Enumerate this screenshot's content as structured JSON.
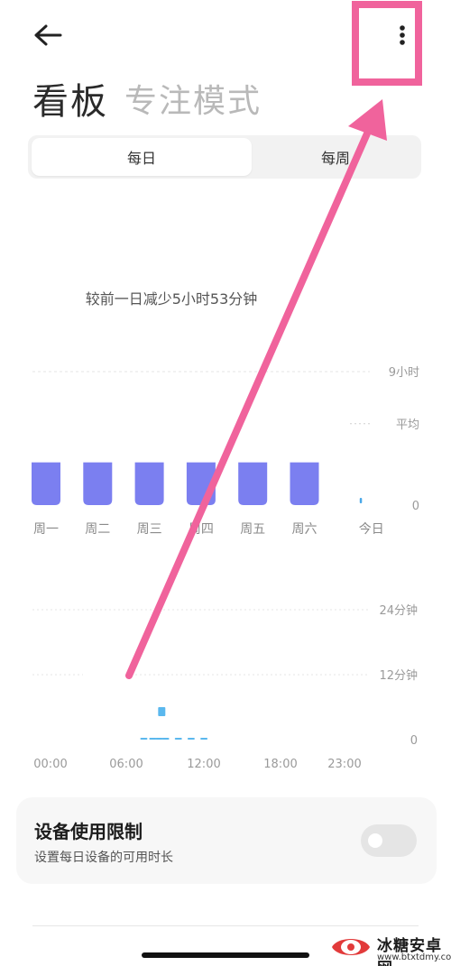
{
  "header": {
    "back_icon": "arrow-left-icon",
    "more_icon": "more-vertical-icon",
    "title": "看板",
    "subtitle": "专注模式"
  },
  "tabs": [
    {
      "label": "每日",
      "active": true
    },
    {
      "label": "每周",
      "active": false
    }
  ],
  "summary": {
    "compare_text": "较前一日减少5小时53分钟"
  },
  "chart_data": [
    {
      "type": "bar",
      "categories": [
        "周一",
        "周二",
        "周三",
        "周四",
        "周五",
        "周六",
        "今日"
      ],
      "values": [
        3.1,
        3.1,
        3.1,
        3.1,
        3.1,
        3.1,
        0.05
      ],
      "y_ticks": [
        "9小时",
        "平均",
        "0"
      ],
      "ylim": [
        0,
        9
      ],
      "average": 5.9,
      "highlight_category": "今日",
      "bar_color": "#7b7ff0",
      "today_color": "#4aa8e8"
    },
    {
      "type": "bar",
      "x_ticks": [
        "00:00",
        "06:00",
        "12:00",
        "18:00",
        "23:00"
      ],
      "y_ticks": [
        "24分钟",
        "12分钟",
        "0"
      ],
      "ylim": [
        0,
        24
      ],
      "points": [
        {
          "hour": 7.3,
          "minutes": 0.5
        },
        {
          "hour": 8.0,
          "minutes": 0.5
        },
        {
          "hour": 8.5,
          "minutes": 0.5
        },
        {
          "hour": 8.7,
          "minutes": 5
        },
        {
          "hour": 9.0,
          "minutes": 0.5
        },
        {
          "hour": 10.0,
          "minutes": 0.5
        },
        {
          "hour": 11.0,
          "minutes": 0.5
        },
        {
          "hour": 12.0,
          "minutes": 0.5
        }
      ],
      "bar_color": "#5ab8ee"
    }
  ],
  "limit_card": {
    "title": "设备使用限制",
    "subtitle": "设置每日设备的可用时长",
    "toggle_on": false
  },
  "watermark": {
    "text_cn": "冰糖安卓网",
    "url": "www.btxtdmy.com"
  },
  "annotation": {
    "color": "#f0639c"
  }
}
